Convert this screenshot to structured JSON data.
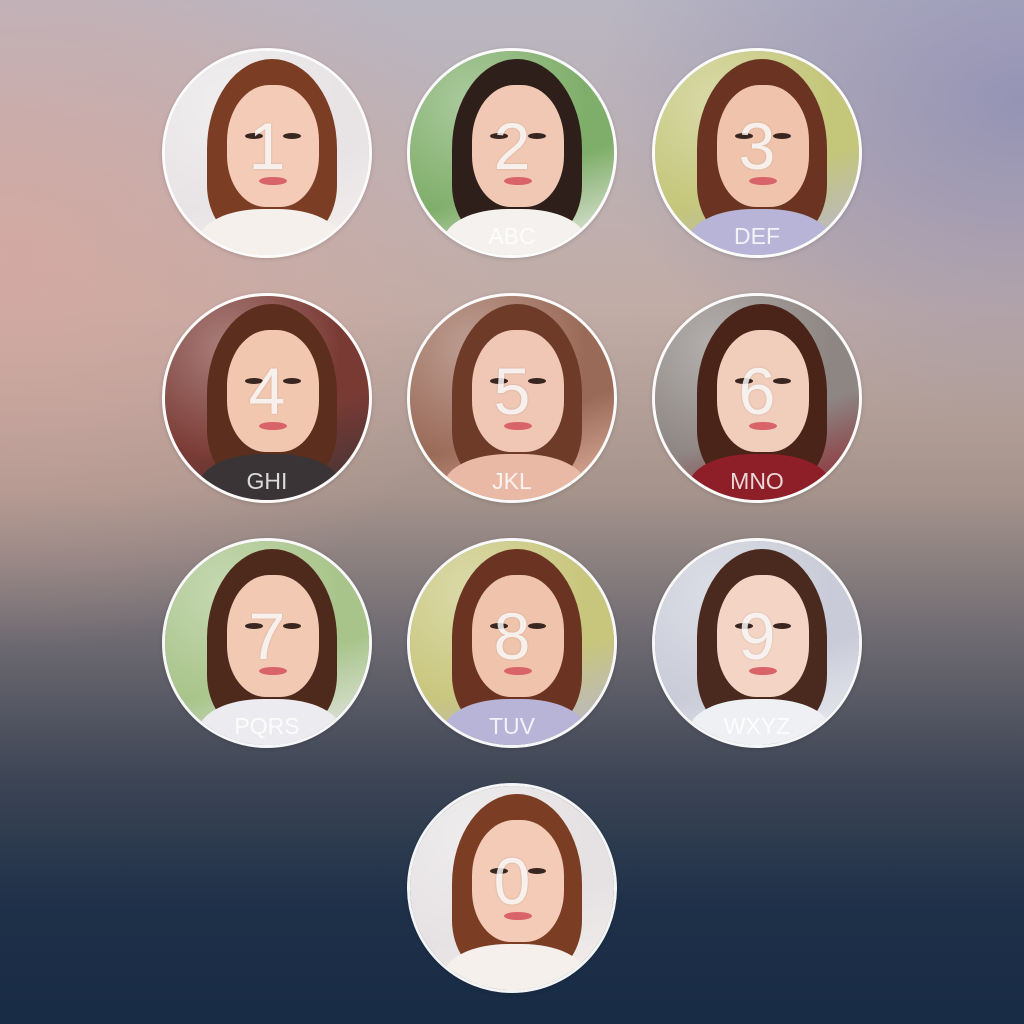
{
  "keypad": {
    "keys": [
      {
        "digit": "1",
        "letters": "",
        "photo": {
          "bg": "#e8e4e6",
          "hair": "#7b3d24",
          "skin": "#f3cbb6",
          "accent": "#f5f0ec"
        }
      },
      {
        "digit": "2",
        "letters": "ABC",
        "photo": {
          "bg": "#7fae6a",
          "hair": "#2e1f1a",
          "skin": "#f1c8b3",
          "accent": "#f4f1ee"
        }
      },
      {
        "digit": "3",
        "letters": "DEF",
        "photo": {
          "bg": "#c4c67a",
          "hair": "#6b3422",
          "skin": "#f0c4ac",
          "accent": "#b7b4d8"
        }
      },
      {
        "digit": "4",
        "letters": "GHI",
        "photo": {
          "bg": "#7a3a34",
          "hair": "#5c2e1e",
          "skin": "#f2c7b0",
          "accent": "#3a3436"
        }
      },
      {
        "digit": "5",
        "letters": "JKL",
        "photo": {
          "bg": "#9a6a58",
          "hair": "#6e3b28",
          "skin": "#f0c6b4",
          "accent": "#e9b9a6"
        }
      },
      {
        "digit": "6",
        "letters": "MNO",
        "photo": {
          "bg": "#8d8683",
          "hair": "#4a2418",
          "skin": "#f1cdbc",
          "accent": "#8e1e28"
        }
      },
      {
        "digit": "7",
        "letters": "PQRS",
        "photo": {
          "bg": "#a8c48a",
          "hair": "#4e2a1d",
          "skin": "#f2cab4",
          "accent": "#ecebef"
        }
      },
      {
        "digit": "8",
        "letters": "TUV",
        "photo": {
          "bg": "#c8c67c",
          "hair": "#6b3422",
          "skin": "#f0c4ac",
          "accent": "#b7b4d8"
        }
      },
      {
        "digit": "9",
        "letters": "WXYZ",
        "photo": {
          "bg": "#c9ccd8",
          "hair": "#4a2a1e",
          "skin": "#f4d4c4",
          "accent": "#eef0f4"
        }
      },
      {
        "digit": "0",
        "letters": "",
        "photo": {
          "bg": "#e6e2e4",
          "hair": "#7b3d24",
          "skin": "#f3cbb6",
          "accent": "#f5f0ec"
        }
      }
    ]
  },
  "colors": {
    "ring": "#ffffff",
    "label": "#ffffff"
  }
}
